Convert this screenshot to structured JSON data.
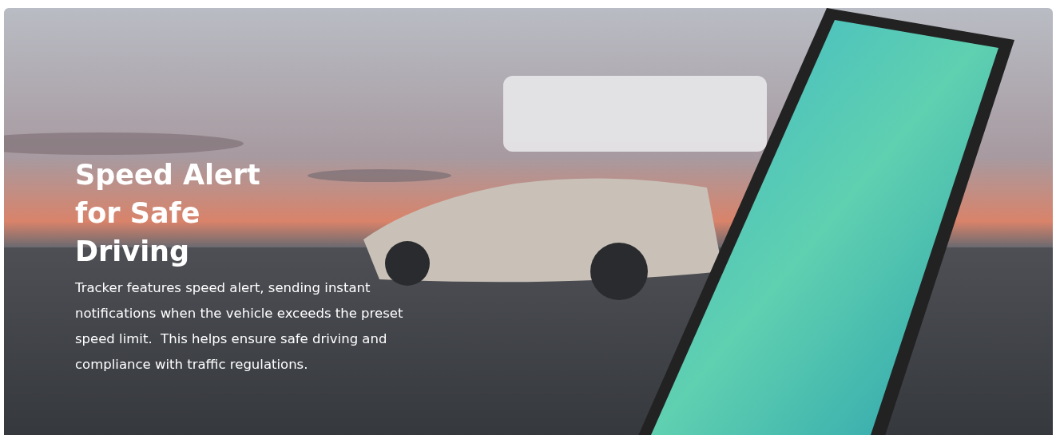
{
  "banner": {
    "title": "Speed Alert for Safe Driving",
    "description": "Tracker features speed alert, sending instant notifications when the vehicle exceeds the preset speed limit.  This helps ensure safe driving and compliance with traffic regulations."
  }
}
